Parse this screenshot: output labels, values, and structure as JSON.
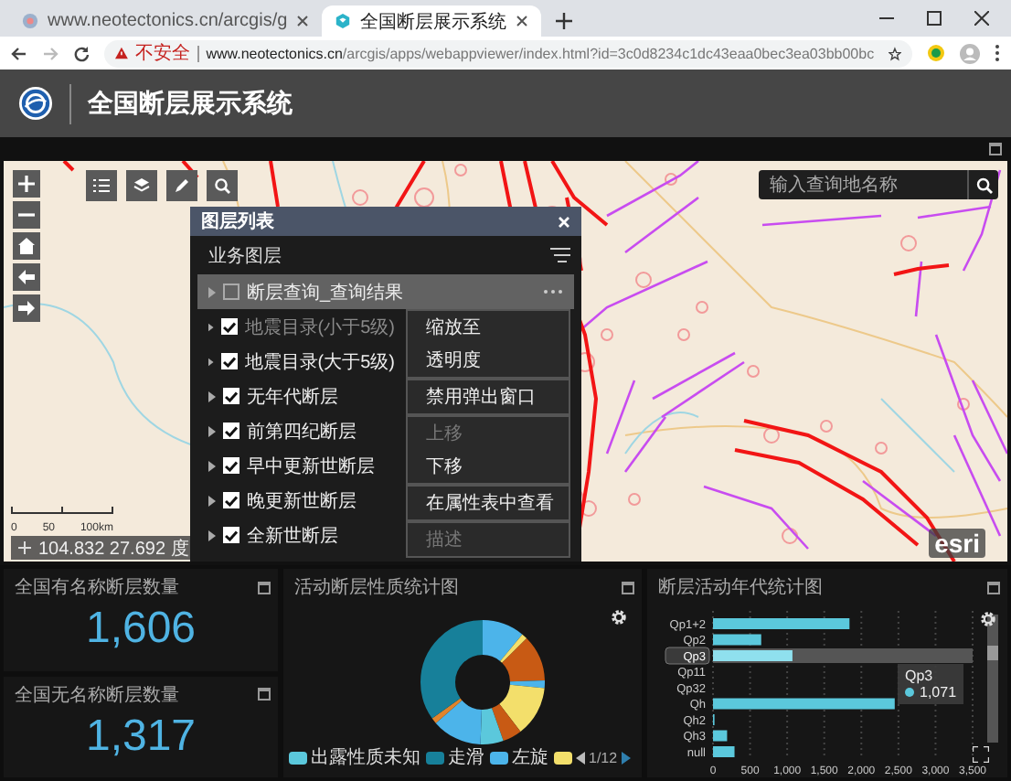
{
  "browser": {
    "tabs": [
      {
        "title": "www.neotectonics.cn/arcgis/g",
        "selected": false
      },
      {
        "title": "全国断层展示系统",
        "selected": true
      }
    ],
    "address": {
      "security": "不安全",
      "host": "www.neotectonics.cn",
      "path": "/arcgis/apps/webappviewer/index.html?id=3c0d8234c1dc43eaa0bec3ea03bb00bc"
    }
  },
  "app": {
    "title": "全国断层展示系统"
  },
  "map": {
    "search": {
      "placeholder": "输入查询地名称"
    },
    "scale_labels": [
      "0",
      "50",
      "100km"
    ],
    "coordinates": "104.832 27.692 度",
    "attribution": "esri"
  },
  "layer_list": {
    "title": "图层列表",
    "section": "业务图层",
    "layers": [
      {
        "name": "断层查询_查询结果",
        "checked": false,
        "selected": true,
        "disabled": false
      },
      {
        "name": "地震目录(小于5级)",
        "checked": true,
        "selected": false,
        "disabled": true
      },
      {
        "name": "地震目录(大于5级)",
        "checked": true,
        "selected": false,
        "disabled": false
      },
      {
        "name": "无年代断层",
        "checked": true,
        "selected": false,
        "disabled": false
      },
      {
        "name": "前第四纪断层",
        "checked": true,
        "selected": false,
        "disabled": false
      },
      {
        "name": "早中更新世断层",
        "checked": true,
        "selected": false,
        "disabled": false
      },
      {
        "name": "晚更新世断层",
        "checked": true,
        "selected": false,
        "disabled": false
      },
      {
        "name": "全新世断层",
        "checked": true,
        "selected": false,
        "disabled": false
      }
    ],
    "menu": [
      {
        "items": [
          {
            "label": "缩放至",
            "disabled": false
          },
          {
            "label": "透明度",
            "disabled": false
          }
        ]
      },
      {
        "items": [
          {
            "label": "禁用弹出窗口",
            "disabled": false
          }
        ]
      },
      {
        "items": [
          {
            "label": "上移",
            "disabled": true
          },
          {
            "label": "下移",
            "disabled": false
          }
        ]
      },
      {
        "items": [
          {
            "label": "在属性表中查看",
            "disabled": false
          }
        ]
      },
      {
        "items": [
          {
            "label": "描述",
            "disabled": true
          }
        ]
      }
    ]
  },
  "stats": [
    {
      "title": "全国有名称断层数量",
      "value": "1,606"
    },
    {
      "title": "全国无名称断层数量",
      "value": "1,317"
    }
  ],
  "donut_chart": {
    "title": "活动断层性质统计图",
    "legend": [
      {
        "label": "出露性质未知",
        "color": "#5bc8dc"
      },
      {
        "label": "走滑",
        "color": "#17809a"
      },
      {
        "label": "左旋",
        "color": "#4cb4ea"
      },
      {
        "color": "#f3df6b"
      }
    ],
    "pager": "1/12"
  },
  "bar_chart": {
    "title": "断层活动年代统计图",
    "chart_data": {
      "type": "bar",
      "orientation": "horizontal",
      "categories": [
        "Qp1+2",
        "Qp2",
        "Qp3",
        "Qp11",
        "Qp32",
        "Qh",
        "Qh2",
        "Qh3",
        "null"
      ],
      "values": [
        1840,
        650,
        1071,
        0,
        0,
        2450,
        20,
        190,
        290
      ],
      "xlim": [
        0,
        3500
      ],
      "grid": true,
      "xticks": [
        {
          "value": 0,
          "label": "0"
        },
        {
          "value": 500,
          "label": "500"
        },
        {
          "value": 1000,
          "label": "1,000"
        },
        {
          "value": 1500,
          "label": "1,500"
        },
        {
          "value": 2000,
          "label": "2,000"
        },
        {
          "value": 2500,
          "label": "2,500"
        },
        {
          "value": 3000,
          "label": "3,000"
        },
        {
          "value": 3500,
          "label": "3,500"
        }
      ]
    },
    "category_states": [
      {
        "selected": false
      },
      {
        "selected": false
      },
      {
        "selected": true
      },
      {
        "selected": false
      },
      {
        "selected": false
      },
      {
        "selected": false
      },
      {
        "selected": false
      },
      {
        "selected": false
      },
      {
        "selected": false
      }
    ],
    "tooltip": {
      "label": "Qp3",
      "value": "1,071"
    }
  }
}
